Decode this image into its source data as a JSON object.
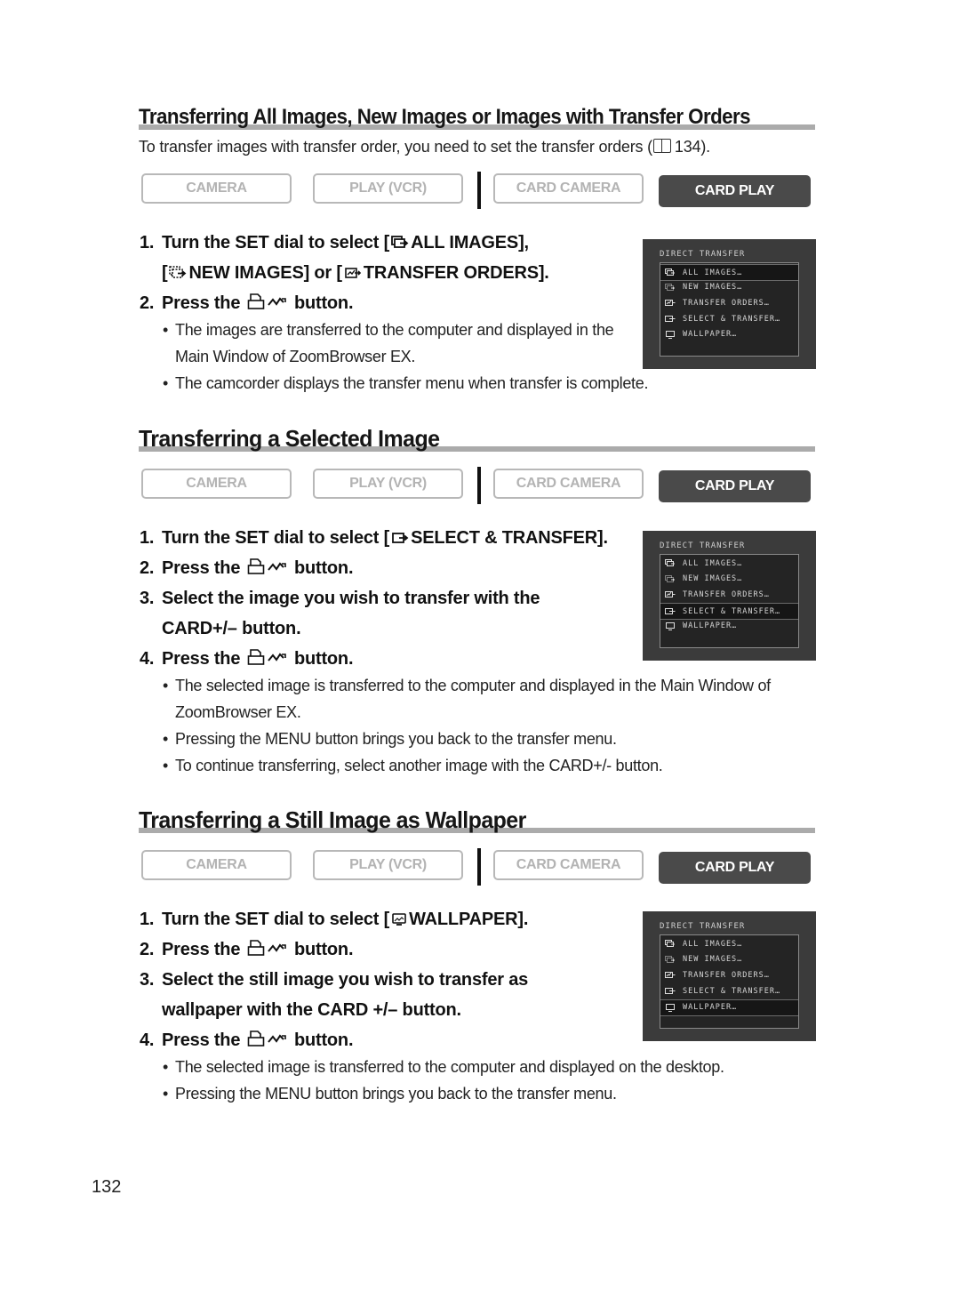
{
  "page_number": "132",
  "modes": [
    "CAMERA",
    "PLAY (VCR)",
    "CARD CAMERA",
    "CARD PLAY"
  ],
  "active_mode": "CARD PLAY",
  "lcd_menu": {
    "title": "DIRECT TRANSFER",
    "items": [
      "ALL IMAGES…",
      "NEW IMAGES…",
      "TRANSFER ORDERS…",
      "SELECT & TRANSFER…",
      "WALLPAPER…"
    ]
  },
  "sections": [
    {
      "title": "Transferring All Images, New Images or Images with Transfer Orders",
      "intro": "To transfer images with transfer order, you need to set the transfer orders (",
      "intro_ref": "134).",
      "steps": [
        {
          "num": "1.",
          "parts": [
            "Turn the SET dial to select [",
            "ALL IMAGES],"
          ]
        },
        {
          "num": "",
          "parts": [
            "[",
            "NEW IMAGES] or [",
            "TRANSFER ORDERS]."
          ]
        },
        {
          "num": "2.",
          "parts": [
            "Press the ",
            " button."
          ]
        }
      ],
      "notes": [
        "The images are transferred to the computer and displayed in the Main Window of ZoomBrowser EX.",
        "The camcorder displays the transfer menu when transfer is complete."
      ],
      "lcd_selected": "ALL IMAGES…"
    },
    {
      "title": "Transferring a Selected Image",
      "steps": [
        {
          "num": "1.",
          "parts": [
            "Turn the SET dial to select [",
            "SELECT & TRANSFER]."
          ]
        },
        {
          "num": "2.",
          "parts": [
            "Press the ",
            " button."
          ]
        },
        {
          "num": "3.",
          "parts": [
            "Select the image you wish to transfer with the"
          ]
        },
        {
          "num": "",
          "parts": [
            "CARD+/– button."
          ]
        },
        {
          "num": "4.",
          "parts": [
            "Press the ",
            " button."
          ]
        }
      ],
      "notes": [
        "The selected image is transferred to the computer and displayed in the Main Window of ZoomBrowser EX.",
        "Pressing the MENU button brings you back to the transfer menu.",
        "To continue transferring, select another image with the CARD+/- button."
      ],
      "lcd_selected": "SELECT & TRANSFER…"
    },
    {
      "title": "Transferring a Still Image as Wallpaper",
      "steps": [
        {
          "num": "1.",
          "parts": [
            "Turn the SET dial to select [",
            "WALLPAPER]."
          ]
        },
        {
          "num": "2.",
          "parts": [
            "Press the ",
            " button."
          ]
        },
        {
          "num": "3.",
          "parts": [
            "Select the still image you wish to transfer as"
          ]
        },
        {
          "num": "",
          "parts": [
            "wallpaper with the CARD +/– button."
          ]
        },
        {
          "num": "4.",
          "parts": [
            "Press the ",
            " button."
          ]
        }
      ],
      "notes": [
        "The selected image is transferred to the computer and displayed on the desktop.",
        "Pressing the MENU button brings you back to the transfer menu."
      ],
      "lcd_selected": "WALLPAPER…"
    }
  ],
  "icons": {
    "all_images": "all-images-icon",
    "new_images": "new-images-icon",
    "transfer_orders": "transfer-orders-icon",
    "select_transfer": "select-transfer-icon",
    "wallpaper": "wallpaper-icon",
    "print_share": "print-share-button-icon",
    "book_ref": "book-reference-icon"
  }
}
